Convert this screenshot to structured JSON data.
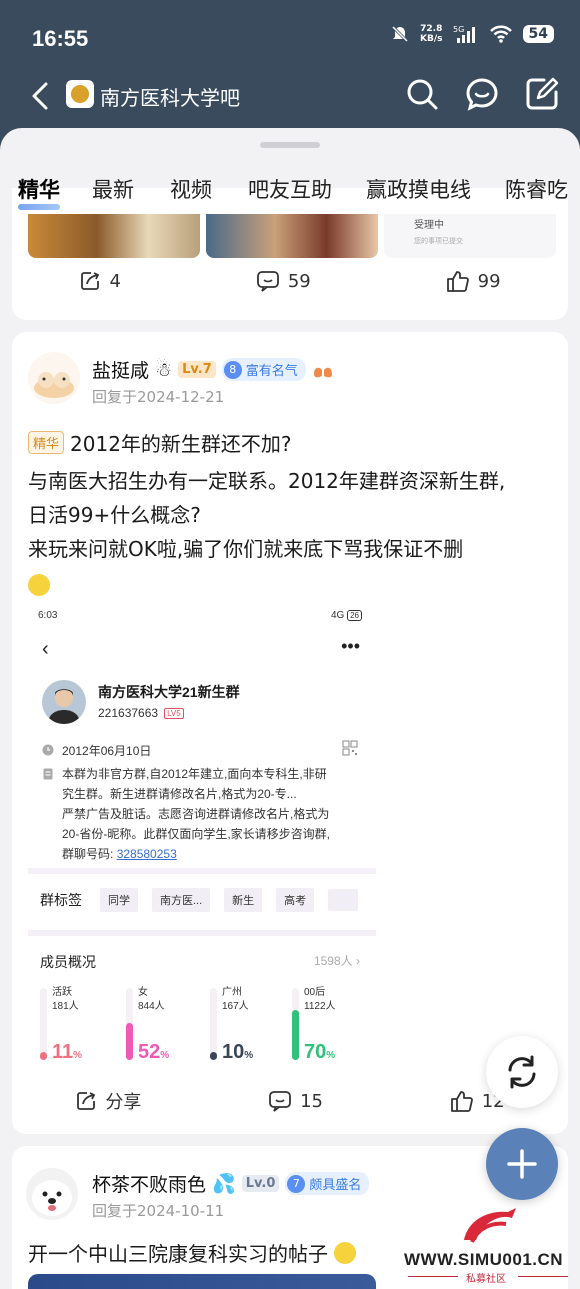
{
  "status_bar": {
    "time": "16:55",
    "speed_value": "72.8",
    "speed_unit": "KB/s",
    "network": "5G",
    "battery": "54"
  },
  "header": {
    "title": "南方医科大学吧"
  },
  "tabs": [
    "精华",
    "最新",
    "视频",
    "吧友互助",
    "赢政摸电线",
    "陈睿吃"
  ],
  "top_card": {
    "thumb_text_1": "受理中",
    "thumb_text_2": "您的事项已提交",
    "share_count": "4",
    "comment_count": "59",
    "like_count": "99"
  },
  "post1": {
    "username": "盐挺咸",
    "level": "Lv.7",
    "badge_num": "8",
    "badge_text": "富有名气",
    "reply_time": "回复于2024-12-21",
    "tag": "精华",
    "title": "2012年的新生群还不加?",
    "body_line1": "与南医大招生办有一定联系。2012年建群资深新生群,",
    "body_line2": "日活99+什么概念?",
    "body_line3": "来玩来问就OK啦,骗了你们就来底下骂我保证不删",
    "share_label": "分享",
    "comment_count": "15",
    "like_count": "12"
  },
  "screenshot": {
    "time": "6:03",
    "network": "4G",
    "battery": "26",
    "group_name": "南方医科大学21新生群",
    "group_id": "221637663",
    "group_level": "LV5",
    "date": "2012年06月10日",
    "desc_1": "本群为非官方群,自2012年建立,面向本专科生,非研",
    "desc_2": "究生群。新生进群请修改名片,格式为20-专...",
    "desc_3": "严禁广告及脏话。志愿咨询进群请修改名片,格式为",
    "desc_4": "20-省份-昵称。此群仅面向学生,家长请移步咨询群,",
    "desc_5": "群聊号码:",
    "link": "328580253",
    "tags_label": "群标签",
    "tags": [
      "同学",
      "南方医...",
      "新生",
      "高考"
    ],
    "members_title": "成员概况",
    "members_count": "1598人",
    "stats": [
      {
        "name": "活跃",
        "count": "181人",
        "pct": "11",
        "unit": "%",
        "color": "#f07080",
        "fill": 0.11
      },
      {
        "name": "女",
        "count": "844人",
        "pct": "52",
        "unit": "%",
        "color": "#ee5ab4",
        "fill": 0.52
      },
      {
        "name": "广州",
        "count": "167人",
        "pct": "10",
        "unit": "%",
        "color": "#3a4656",
        "fill": 0.1
      },
      {
        "name": "00后",
        "count": "1122人",
        "pct": "70",
        "unit": "%",
        "color": "#2ec27a",
        "fill": 0.7
      }
    ]
  },
  "post2": {
    "username": "杯茶不败雨色",
    "level": "Lv.0",
    "badge_num": "7",
    "badge_text": "颇具盛名",
    "reply_time": "回复于2024-10-11",
    "title": "开一个中山三院康复科实习的帖子"
  },
  "watermark": {
    "text": "WWW.SIMU001.CN",
    "sub": "私募社区"
  }
}
